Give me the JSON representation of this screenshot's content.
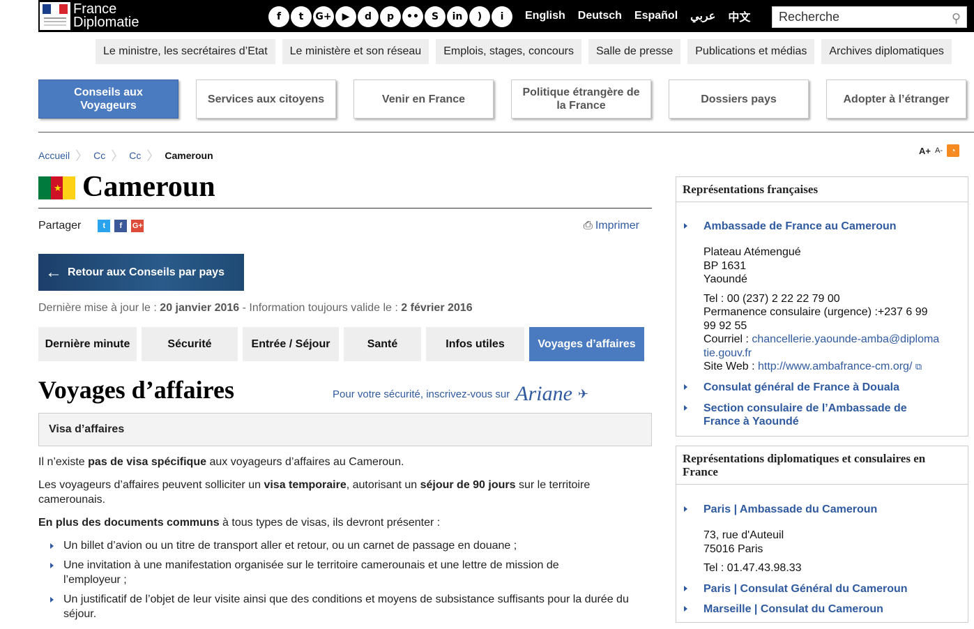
{
  "header": {
    "logo_line1": "France",
    "logo_line2": "Diplomatie",
    "social_icons": [
      "facebook-icon",
      "twitter-icon",
      "googleplus-icon",
      "youtube-icon",
      "dailymotion-icon",
      "pinterest-icon",
      "flickr-icon",
      "storify-icon",
      "linkedin-icon",
      "rss-icon",
      "info-icon"
    ],
    "languages": [
      "English",
      "Deutsch",
      "Español",
      "عربي",
      "中文"
    ],
    "search_placeholder": "Recherche"
  },
  "subnav": [
    "Le ministre, les secrétaires d’Etat",
    "Le ministère et son réseau",
    "Emplois, stages, concours",
    "Salle de presse",
    "Publications et médias",
    "Archives diplomatiques"
  ],
  "mainnav": [
    {
      "label": "Conseils aux Voyageurs",
      "active": true
    },
    {
      "label": "Services aux citoyens",
      "active": false
    },
    {
      "label": "Venir en France",
      "active": false
    },
    {
      "label": "Politique étrangère de la France",
      "active": false
    },
    {
      "label": "Dossiers pays",
      "active": false
    },
    {
      "label": "Adopter à l’étranger",
      "active": false
    }
  ],
  "breadcrumb": {
    "home": "Accueil",
    "crumb2": "Cc",
    "crumb3": "Cc",
    "current": "Cameroun"
  },
  "tools": {
    "font_plus": "A+",
    "font_minus": "A-"
  },
  "page": {
    "title": "Cameroun",
    "share_label": "Partager",
    "print_label": "Imprimer",
    "back_label": "Retour aux Conseils par pays",
    "update_prefix": "Dernière mise à jour le : ",
    "update_date": "20 janvier 2016",
    "valid_prefix": " - Information toujours valide le : ",
    "valid_date": "2 février 2016"
  },
  "tabs": [
    {
      "label": "Dernière minute",
      "active": false
    },
    {
      "label": "Sécurité",
      "active": false
    },
    {
      "label": "Entrée / Séjour",
      "active": false
    },
    {
      "label": "Santé",
      "active": false
    },
    {
      "label": "Infos utiles",
      "active": false
    },
    {
      "label": "Voyages d’affaires",
      "active": true
    }
  ],
  "section": {
    "title": "Voyages d’affaires",
    "ariane_text": "Pour votre sécurité, inscrivez-vous sur",
    "ariane_logo": "Ariane",
    "subhead": "Visa d’affaires"
  },
  "content": {
    "p1_a": "Il n’existe ",
    "p1_b": "pas de visa spécifique",
    "p1_c": " aux voyageurs d’affaires au Cameroun.",
    "p2_a": "Les voyageurs d’affaires peuvent solliciter un ",
    "p2_b": "visa temporaire",
    "p2_c": ", autorisant un ",
    "p2_d": "séjour de 90 jours",
    "p2_e": " sur le territoire camerounais.",
    "p3_a": "En plus des documents communs",
    "p3_b": " à tous types de visas, ils devront présenter :",
    "list": [
      "Un billet d’avion ou un titre de transport aller et retour, ou un carnet de passage en douane ;",
      "Une invitation à une manifestation organisée sur le territoire camerounais et une lettre de mission de l’employeur ;",
      "Un justificatif de l’objet de leur visite ainsi que des conditions et moyens de subsistance suffisants pour la durée du séjour."
    ]
  },
  "sidebar": {
    "box1": {
      "title": "Représentations françaises",
      "item1": "Ambassade de France au Cameroun",
      "addr1": "Plateau Atémengué",
      "addr2": "BP 1631",
      "addr3": "Yaoundé",
      "tel": "Tel : 00 (237) 2 22 22 79 00",
      "perm": "Permanence consulaire (urgence) :+237 6 99 99 92 55",
      "mail_label": "Courriel : ",
      "mail": "chancellerie.yaounde-amba@diplomatie.gouv.fr",
      "web_label": "Site Web : ",
      "web": "http://www.ambafrance-cm.org/",
      "item2": "Consulat général de France à Douala",
      "item3": "Section consulaire de l’Ambassade de France à Yaoundé"
    },
    "box2": {
      "title": "Représentations diplomatiques et consulaires en France",
      "item1": "Paris | Ambassade du Cameroun",
      "addr1": "73, rue d'Auteuil",
      "addr2": "75016 Paris",
      "tel": "Tel : 01.47.43.98.33",
      "item2": "Paris | Consulat Général du Cameroun",
      "item3": "Marseille | Consulat du Cameroun"
    }
  },
  "colors": {
    "accent": "#4a7ac0",
    "link": "#2f5aa0",
    "cameroon_green": "#007a3d",
    "cameroon_red": "#ce1126",
    "cameroon_yellow": "#fcd116"
  }
}
